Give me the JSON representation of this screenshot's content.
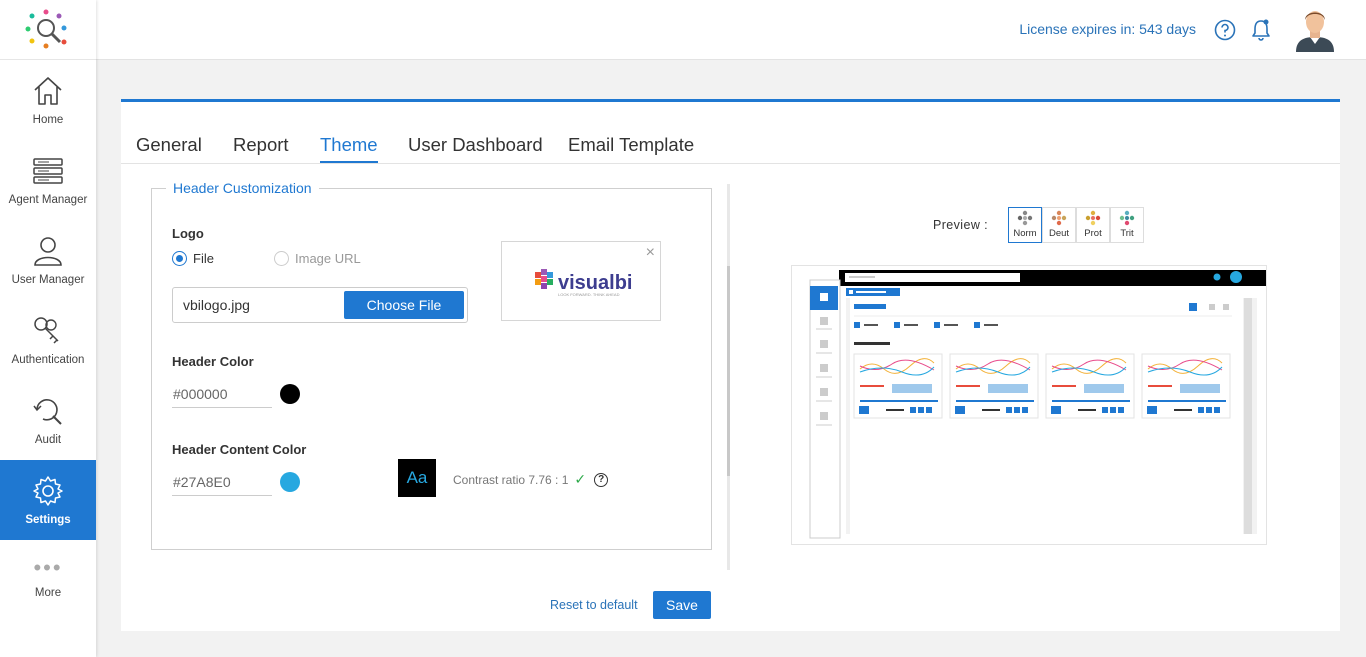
{
  "app": {
    "license_text": "License expires in: 543 days"
  },
  "sidebar": {
    "items": [
      {
        "label": "Home",
        "icon": "home-icon"
      },
      {
        "label": "Agent Manager",
        "icon": "server-icon"
      },
      {
        "label": "User Manager",
        "icon": "user-icon"
      },
      {
        "label": "Authentication",
        "icon": "keys-icon"
      },
      {
        "label": "Audit",
        "icon": "audit-search-icon"
      },
      {
        "label": "Settings",
        "icon": "gear-icon",
        "active": true
      },
      {
        "label": "More",
        "icon": "more-dots-icon"
      }
    ]
  },
  "tabs": [
    {
      "label": "General"
    },
    {
      "label": "Report"
    },
    {
      "label": "Theme",
      "active": true
    },
    {
      "label": "User Dashboard"
    },
    {
      "label": "Email Template"
    }
  ],
  "header_customization": {
    "legend": "Header Customization",
    "logo_label": "Logo",
    "radio_file": "File",
    "radio_url": "Image URL",
    "selected_source": "File",
    "file_name": "vbilogo.jpg",
    "choose_file_label": "Choose File",
    "header_color_label": "Header Color",
    "header_color_value": "#000000",
    "header_content_color_label": "Header Content Color",
    "header_content_color_value": "#27A8E0",
    "aa_sample": "Aa",
    "contrast_text": "Contrast ratio 7.76 : 1",
    "contrast_check": "✓",
    "help_mark": "?"
  },
  "logo_preview": {
    "brand_text": "visualbi",
    "tagline": "LOOK FORWARD. THINK AHEAD",
    "close": "×"
  },
  "actions": {
    "reset_label": "Reset to default",
    "save_label": "Save"
  },
  "preview": {
    "label": "Preview :",
    "modes": [
      {
        "label": "Norm",
        "active": true
      },
      {
        "label": "Deut"
      },
      {
        "label": "Prot"
      },
      {
        "label": "Trit"
      }
    ]
  },
  "colors": {
    "accent": "#1f78d1",
    "header_color": "#000000",
    "header_content_color": "#27A8E0"
  }
}
